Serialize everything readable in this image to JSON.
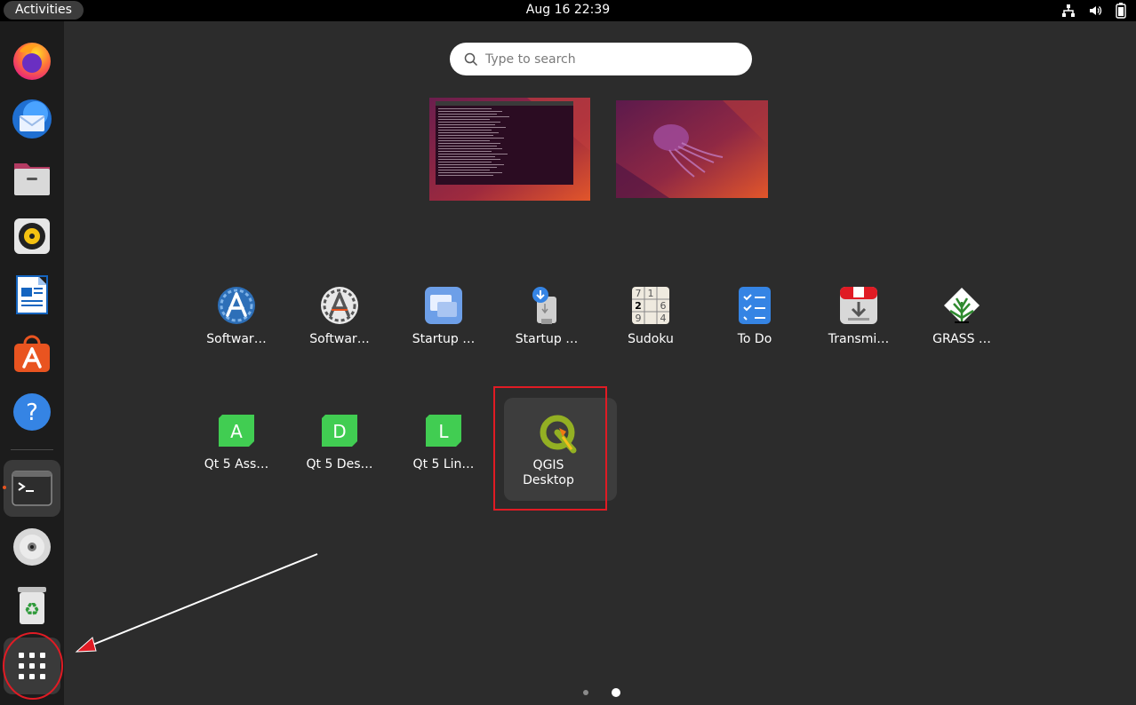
{
  "topbar": {
    "activities": "Activities",
    "clock": "Aug 16  22:39",
    "tray_icons": [
      "network-icon",
      "volume-icon",
      "battery-icon"
    ]
  },
  "dock": {
    "items": [
      {
        "name": "firefox",
        "icon": "firefox-icon"
      },
      {
        "name": "thunderbird",
        "icon": "thunderbird-icon"
      },
      {
        "name": "files",
        "icon": "files-icon"
      },
      {
        "name": "rhythmbox",
        "icon": "rhythmbox-icon"
      },
      {
        "name": "libreoffice-writer",
        "icon": "writer-icon"
      },
      {
        "name": "ubuntu-software",
        "icon": "software-icon"
      },
      {
        "name": "help",
        "icon": "help-icon"
      },
      {
        "name": "terminal",
        "icon": "terminal-icon",
        "running": true
      },
      {
        "name": "disc",
        "icon": "disc-icon"
      },
      {
        "name": "trash",
        "icon": "trash-icon"
      },
      {
        "name": "show-applications",
        "icon": "grid-icon"
      }
    ]
  },
  "search": {
    "placeholder": "Type to search"
  },
  "apps_row1": [
    {
      "label": "Softwar…",
      "icon": "software-properties-icon"
    },
    {
      "label": "Softwar…",
      "icon": "software-updater-icon"
    },
    {
      "label": "Startup …",
      "icon": "startup-apps-icon"
    },
    {
      "label": "Startup …",
      "icon": "startup-disk-icon"
    },
    {
      "label": "Sudoku",
      "icon": "sudoku-icon"
    },
    {
      "label": "To Do",
      "icon": "todo-icon"
    },
    {
      "label": "Transmi…",
      "icon": "transmission-icon"
    },
    {
      "label": "GRASS …",
      "icon": "grass-icon"
    }
  ],
  "apps_row2": [
    {
      "label": "Qt 5 Ass…",
      "icon": "qt-assistant-icon",
      "letter": "A"
    },
    {
      "label": "Qt 5 Des…",
      "icon": "qt-designer-icon",
      "letter": "D"
    },
    {
      "label": "Qt 5 Lin…",
      "icon": "qt-linguist-icon",
      "letter": "L"
    }
  ],
  "qgis": {
    "label_line1": "QGIS",
    "label_line2": "Desktop",
    "icon": "qgis-icon"
  },
  "sudoku_digits": [
    "7",
    "1",
    "2",
    "6",
    "9",
    "4"
  ],
  "page_dots": {
    "count": 2,
    "current": 2
  },
  "colors": {
    "accent": "#e95420",
    "highlight_red": "#e01b24",
    "background": "#2c2c2c",
    "dock": "#1c1c1c"
  }
}
